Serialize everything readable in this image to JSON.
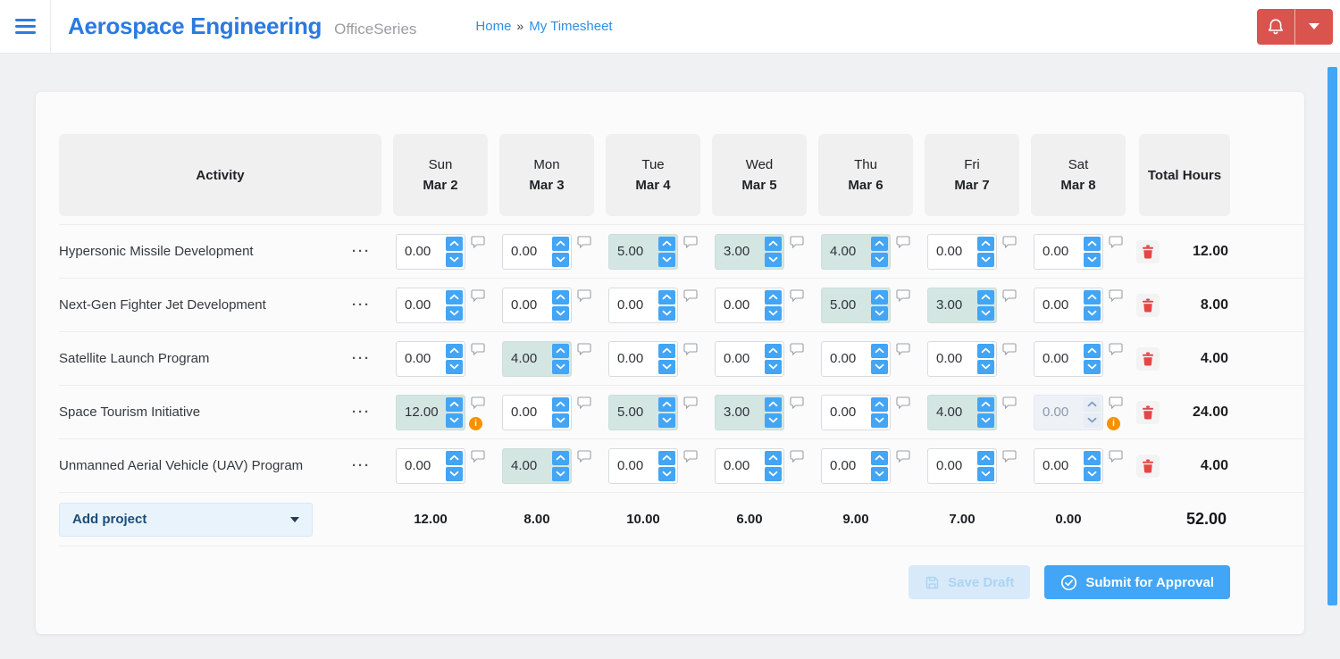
{
  "header": {
    "title": "Aerospace Engineering",
    "product": "OfficeSeries",
    "breadcrumb": {
      "home": "Home",
      "separator": "»",
      "current": "My Timesheet"
    }
  },
  "timesheet": {
    "columns": {
      "activity": "Activity",
      "total": "Total Hours",
      "days": [
        {
          "name": "Sun",
          "date": "Mar 2"
        },
        {
          "name": "Mon",
          "date": "Mar 3"
        },
        {
          "name": "Tue",
          "date": "Mar 4"
        },
        {
          "name": "Wed",
          "date": "Mar 5"
        },
        {
          "name": "Thu",
          "date": "Mar 6"
        },
        {
          "name": "Fri",
          "date": "Mar 7"
        },
        {
          "name": "Sat",
          "date": "Mar 8"
        }
      ]
    },
    "row_menu_glyph": "···",
    "info_glyph": "i",
    "rows": [
      {
        "activity": "Hypersonic Missile Development",
        "cells": [
          {
            "value": "0.00"
          },
          {
            "value": "0.00"
          },
          {
            "value": "5.00",
            "highlight": true
          },
          {
            "value": "3.00",
            "highlight": true
          },
          {
            "value": "4.00",
            "highlight": true
          },
          {
            "value": "0.00"
          },
          {
            "value": "0.00"
          }
        ],
        "total": "12.00"
      },
      {
        "activity": "Next-Gen Fighter Jet Development",
        "cells": [
          {
            "value": "0.00"
          },
          {
            "value": "0.00"
          },
          {
            "value": "0.00"
          },
          {
            "value": "0.00"
          },
          {
            "value": "5.00",
            "highlight": true
          },
          {
            "value": "3.00",
            "highlight": true
          },
          {
            "value": "0.00"
          }
        ],
        "total": "8.00"
      },
      {
        "activity": "Satellite Launch Program",
        "cells": [
          {
            "value": "0.00"
          },
          {
            "value": "4.00",
            "highlight": true
          },
          {
            "value": "0.00"
          },
          {
            "value": "0.00"
          },
          {
            "value": "0.00"
          },
          {
            "value": "0.00"
          },
          {
            "value": "0.00"
          }
        ],
        "total": "4.00"
      },
      {
        "activity": "Space Tourism Initiative",
        "cells": [
          {
            "value": "12.00",
            "highlight": true,
            "info": true
          },
          {
            "value": "0.00"
          },
          {
            "value": "5.00",
            "highlight": true
          },
          {
            "value": "3.00",
            "highlight": true
          },
          {
            "value": "0.00"
          },
          {
            "value": "4.00",
            "highlight": true
          },
          {
            "value": "0.00",
            "disabled": true,
            "info": true
          }
        ],
        "total": "24.00"
      },
      {
        "activity": "Unmanned Aerial Vehicle (UAV) Program",
        "cells": [
          {
            "value": "0.00"
          },
          {
            "value": "4.00",
            "highlight": true
          },
          {
            "value": "0.00"
          },
          {
            "value": "0.00"
          },
          {
            "value": "0.00"
          },
          {
            "value": "0.00"
          },
          {
            "value": "0.00"
          }
        ],
        "total": "4.00"
      }
    ],
    "footer": {
      "add_project_label": "Add project",
      "day_totals": [
        "12.00",
        "8.00",
        "10.00",
        "6.00",
        "9.00",
        "7.00",
        "0.00"
      ],
      "grand_total": "52.00"
    },
    "actions": {
      "save_draft": "Save Draft",
      "submit": "Submit for Approval"
    }
  },
  "colors": {
    "accent_blue": "#42a5f5",
    "brand_blue": "#2a7ae2",
    "danger_red": "#d9534f",
    "cell_highlight": "#d4e6e2",
    "warning_orange": "#f59100",
    "trash_red": "#e64545"
  }
}
